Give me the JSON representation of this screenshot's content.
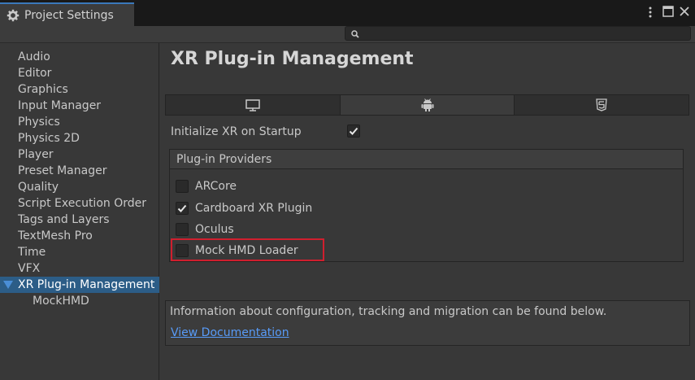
{
  "window": {
    "tab_title": "Project Settings",
    "tab_icon": "gear-icon",
    "controls": [
      "more-options-icon",
      "maximize-icon",
      "close-icon"
    ],
    "search": {
      "placeholder": "",
      "value": ""
    }
  },
  "sidebar": {
    "items": [
      {
        "label": "Audio"
      },
      {
        "label": "Editor"
      },
      {
        "label": "Graphics"
      },
      {
        "label": "Input Manager"
      },
      {
        "label": "Physics"
      },
      {
        "label": "Physics 2D"
      },
      {
        "label": "Player"
      },
      {
        "label": "Preset Manager"
      },
      {
        "label": "Quality"
      },
      {
        "label": "Script Execution Order"
      },
      {
        "label": "Tags and Layers"
      },
      {
        "label": "TextMesh Pro"
      },
      {
        "label": "Time"
      },
      {
        "label": "VFX"
      },
      {
        "label": "XR Plug-in Management",
        "selected": true,
        "expanded": true
      },
      {
        "label": "MockHMD",
        "child": true
      }
    ]
  },
  "main": {
    "title": "XR Plug-in Management",
    "platform_tabs": [
      {
        "icon": "desktop-icon",
        "active": false
      },
      {
        "icon": "android-icon",
        "active": true
      },
      {
        "icon": "html5-icon",
        "active": false
      }
    ],
    "init_xr": {
      "label": "Initialize XR on Startup",
      "checked": true
    },
    "providers": {
      "header": "Plug-in Providers",
      "items": [
        {
          "label": "ARCore",
          "checked": false
        },
        {
          "label": "Cardboard XR Plugin",
          "checked": true
        },
        {
          "label": "Oculus",
          "checked": false
        },
        {
          "label": "Mock HMD Loader",
          "checked": false,
          "highlighted": true
        }
      ]
    },
    "info": {
      "text": "Information about configuration, tracking and migration can be found below.",
      "link": "View Documentation"
    }
  },
  "colors": {
    "accent": "#3a79bb",
    "selection": "#2c5d87",
    "link": "#589bf7",
    "highlight": "#d01f2e",
    "panel": "#383838"
  }
}
